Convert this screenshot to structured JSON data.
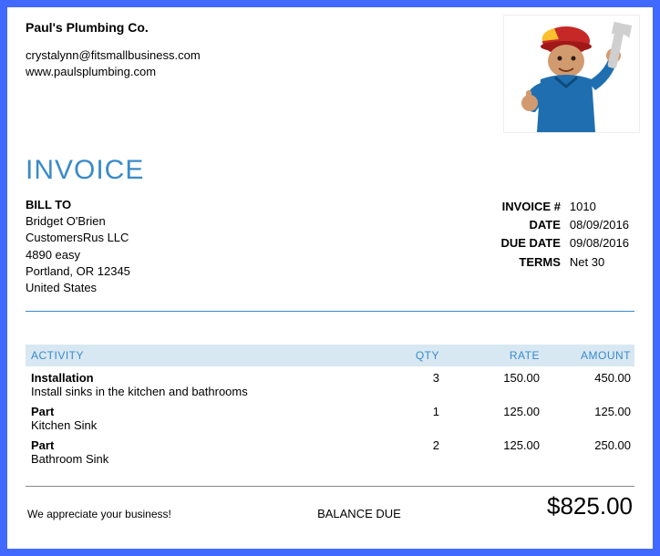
{
  "company": {
    "name": "Paul's Plumbing Co.",
    "email": "crystalynn@fitsmallbusiness.com",
    "website": "www.paulsplumbing.com"
  },
  "title": "INVOICE",
  "bill_to": {
    "label": "BILL TO",
    "name": "Bridget O'Brien",
    "company": "CustomersRus LLC",
    "street": "4890 easy",
    "city_line": "Portland, OR  12345",
    "country": "United States"
  },
  "meta": {
    "invoice_label": "INVOICE #",
    "invoice_number": "1010",
    "date_label": "DATE",
    "date": "08/09/2016",
    "due_date_label": "DUE DATE",
    "due_date": "09/08/2016",
    "terms_label": "TERMS",
    "terms": "Net 30"
  },
  "columns": {
    "activity": "ACTIVITY",
    "qty": "QTY",
    "rate": "RATE",
    "amount": "AMOUNT"
  },
  "items": [
    {
      "name": "Installation",
      "desc": "Install sinks in the kitchen and bathrooms",
      "qty": "3",
      "rate": "150.00",
      "amount": "450.00"
    },
    {
      "name": "Part",
      "desc": "Kitchen Sink",
      "qty": "1",
      "rate": "125.00",
      "amount": "125.00"
    },
    {
      "name": "Part",
      "desc": "Bathroom Sink",
      "qty": "2",
      "rate": "125.00",
      "amount": "250.00"
    }
  ],
  "footer": {
    "note": "We appreciate your business!",
    "balance_label": "BALANCE DUE",
    "balance_amount": "$825.00"
  }
}
